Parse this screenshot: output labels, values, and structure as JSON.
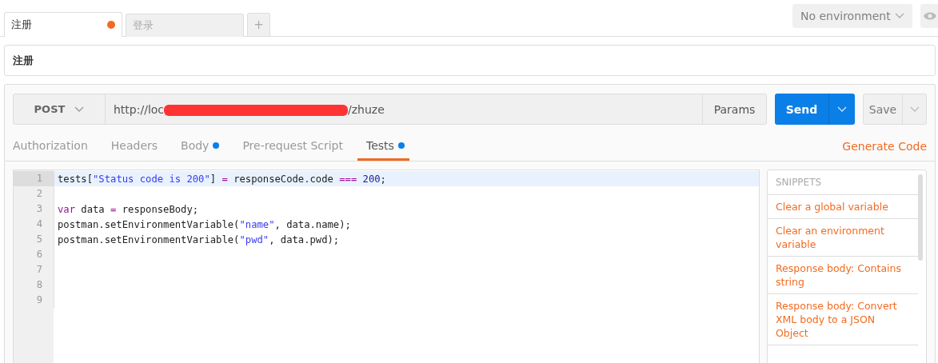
{
  "tabs": [
    {
      "label": "注册",
      "selected": true,
      "unsaved": true
    },
    {
      "label": "登录",
      "selected": false,
      "unsaved": false
    }
  ],
  "new_tab_button": "+",
  "environment": {
    "label": "No environment"
  },
  "request_name": "注册",
  "request": {
    "method": "POST",
    "url_start": "http://loc",
    "url_end": "/zhuze",
    "params_button": "Params",
    "send_button": "Send",
    "save_button": "Save"
  },
  "subtabs": [
    {
      "label": "Authorization",
      "selected": false,
      "has_content": false
    },
    {
      "label": "Headers",
      "selected": false,
      "has_content": false
    },
    {
      "label": "Body",
      "selected": false,
      "has_content": true
    },
    {
      "label": "Pre-request Script",
      "selected": false,
      "has_content": false
    },
    {
      "label": "Tests",
      "selected": true,
      "has_content": true
    }
  ],
  "generate_code_link": "Generate Code",
  "editor": {
    "lines": [
      {
        "number": "1",
        "active": true,
        "tokens": [
          {
            "kind": "plain",
            "text": "tests["
          },
          {
            "kind": "string",
            "text": "\"Status code is 200\""
          },
          {
            "kind": "plain",
            "text": "] "
          },
          {
            "kind": "operator",
            "text": "="
          },
          {
            "kind": "plain",
            "text": " responseCode.code "
          },
          {
            "kind": "operator",
            "text": "=== "
          },
          {
            "kind": "number",
            "text": "200"
          },
          {
            "kind": "plain",
            "text": ";"
          }
        ]
      },
      {
        "number": "2",
        "active": false
      },
      {
        "number": "3",
        "active": false,
        "tokens": [
          {
            "kind": "keyword",
            "text": "var"
          },
          {
            "kind": "plain",
            "text": " data "
          },
          {
            "kind": "operator",
            "text": "="
          },
          {
            "kind": "plain",
            "text": " responseBody;"
          }
        ]
      },
      {
        "number": "4",
        "active": false,
        "tokens": [
          {
            "kind": "plain",
            "text": "postman.setEnvironmentVariable("
          },
          {
            "kind": "string",
            "text": "\"name\""
          },
          {
            "kind": "plain",
            "text": ", data.name);"
          }
        ]
      },
      {
        "number": "5",
        "active": false,
        "tokens": [
          {
            "kind": "plain",
            "text": "postman.setEnvironmentVariable("
          },
          {
            "kind": "string",
            "text": "\"pwd\""
          },
          {
            "kind": "plain",
            "text": ", data.pwd);"
          }
        ]
      },
      {
        "number": "6",
        "active": false
      },
      {
        "number": "7",
        "active": false
      },
      {
        "number": "8",
        "active": false
      },
      {
        "number": "9",
        "active": false
      }
    ]
  },
  "snippets": {
    "title": "SNIPPETS",
    "items": [
      "Clear a global variable",
      "Clear an environment variable",
      "Response body: Contains string",
      "Response body: Convert XML body to a JSON Object"
    ]
  }
}
